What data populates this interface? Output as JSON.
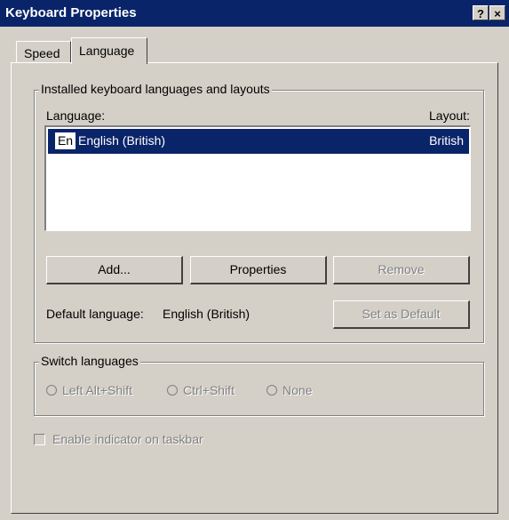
{
  "window": {
    "title": "Keyboard Properties",
    "help_button": "?",
    "close_button": "×"
  },
  "tabs": [
    {
      "label": "Speed",
      "active": false
    },
    {
      "label": "Language",
      "active": true
    }
  ],
  "installed": {
    "group_title": "Installed keyboard languages and layouts",
    "language_header": "Language:",
    "layout_header": "Layout:",
    "rows": [
      {
        "badge": "En",
        "language": "English (British)",
        "layout": "British",
        "selected": true
      }
    ]
  },
  "buttons": {
    "add": "Add...",
    "properties": "Properties",
    "remove": "Remove",
    "set_default": "Set as Default"
  },
  "default_language": {
    "label": "Default language:",
    "value": "English (British)"
  },
  "switch_languages": {
    "group_title": "Switch languages",
    "options": [
      "Left Alt+Shift",
      "Ctrl+Shift",
      "None"
    ]
  },
  "indicator": {
    "label": "Enable indicator on taskbar",
    "checked": false
  },
  "colors": {
    "titlebar": "#0a246a",
    "face": "#d4d0c8",
    "selection": "#0a246a"
  }
}
